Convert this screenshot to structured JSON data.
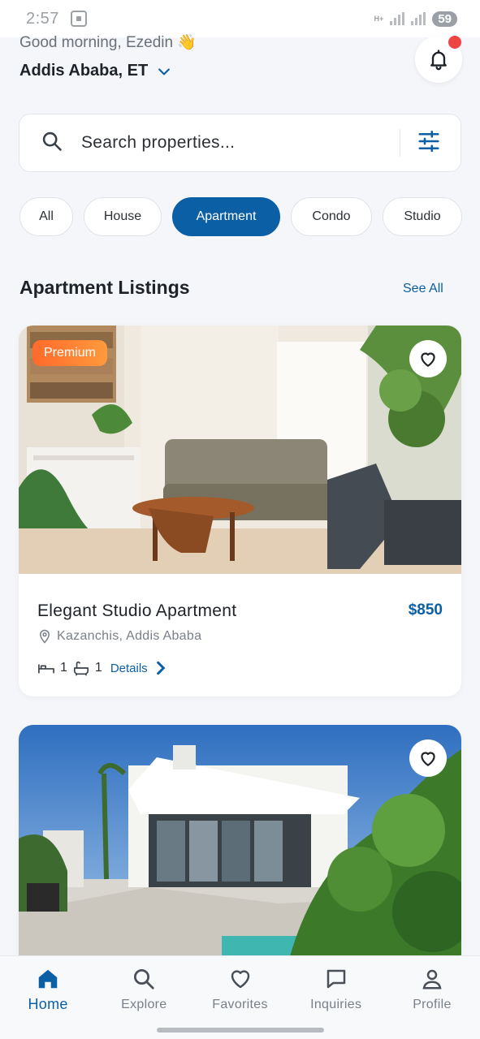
{
  "status_bar": {
    "time": "2:57",
    "data_label": "H+",
    "battery": "59"
  },
  "header": {
    "greeting": "Good morning, Ezedin 👋",
    "location": "Addis Ababa, ET",
    "icons": {
      "location_dropdown": "chevron-down-icon",
      "notifications": "bell-icon"
    }
  },
  "search": {
    "placeholder": "Search properties...",
    "icons": {
      "search": "search-icon",
      "filter": "sliders-icon"
    }
  },
  "categories": [
    {
      "label": "All",
      "active": false
    },
    {
      "label": "House",
      "active": false
    },
    {
      "label": "Apartment",
      "active": true
    },
    {
      "label": "Condo",
      "active": false
    },
    {
      "label": "Studio",
      "active": false
    }
  ],
  "section": {
    "title": "Apartment Listings",
    "see_all": "See All"
  },
  "listings": [
    {
      "badge": "Premium",
      "title": "Elegant Studio Apartment",
      "price": "$850",
      "location": "Kazanchis, Addis Ababa",
      "beds": "1",
      "baths": "1",
      "details_label": "Details"
    },
    {
      "badge": "",
      "title": "",
      "price": "",
      "location": ""
    }
  ],
  "bottom_nav": [
    {
      "label": "Home",
      "icon": "home-icon",
      "active": true
    },
    {
      "label": "Explore",
      "icon": "search-icon",
      "active": false
    },
    {
      "label": "Favorites",
      "icon": "heart-icon",
      "active": false
    },
    {
      "label": "Inquiries",
      "icon": "chat-icon",
      "active": false
    },
    {
      "label": "Profile",
      "icon": "user-icon",
      "active": false
    }
  ],
  "colors": {
    "primary": "#0b5fa5",
    "premium_start": "#ff6a2b",
    "premium_end": "#ff9a3c",
    "notification_dot": "#ef4444"
  }
}
